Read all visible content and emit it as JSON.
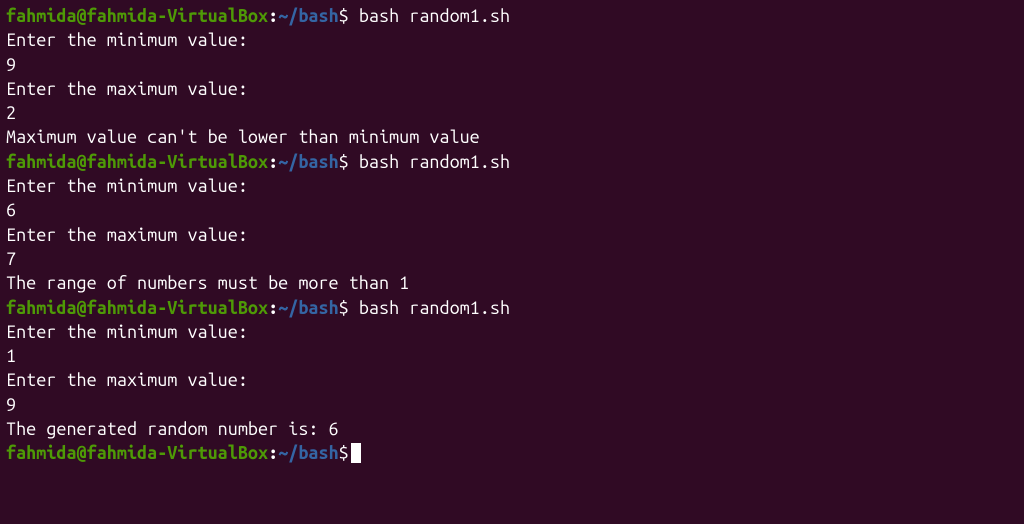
{
  "prompt": {
    "user_host": "fahmida@fahmida-VirtualBox",
    "colon": ":",
    "path": "~/bash",
    "dollar": "$"
  },
  "sessions": [
    {
      "command": " bash random1.sh",
      "lines": [
        "Enter the minimum value:",
        "9",
        "Enter the maximum value:",
        "2",
        "Maximum value can't be lower than minimum value"
      ]
    },
    {
      "command": " bash random1.sh",
      "lines": [
        "Enter the minimum value:",
        "6",
        "Enter the maximum value:",
        "7",
        "The range of numbers must be more than 1"
      ]
    },
    {
      "command": " bash random1.sh",
      "lines": [
        "Enter the minimum value:",
        "1",
        "Enter the maximum value:",
        "9",
        "The generated random number is: 6"
      ]
    }
  ]
}
